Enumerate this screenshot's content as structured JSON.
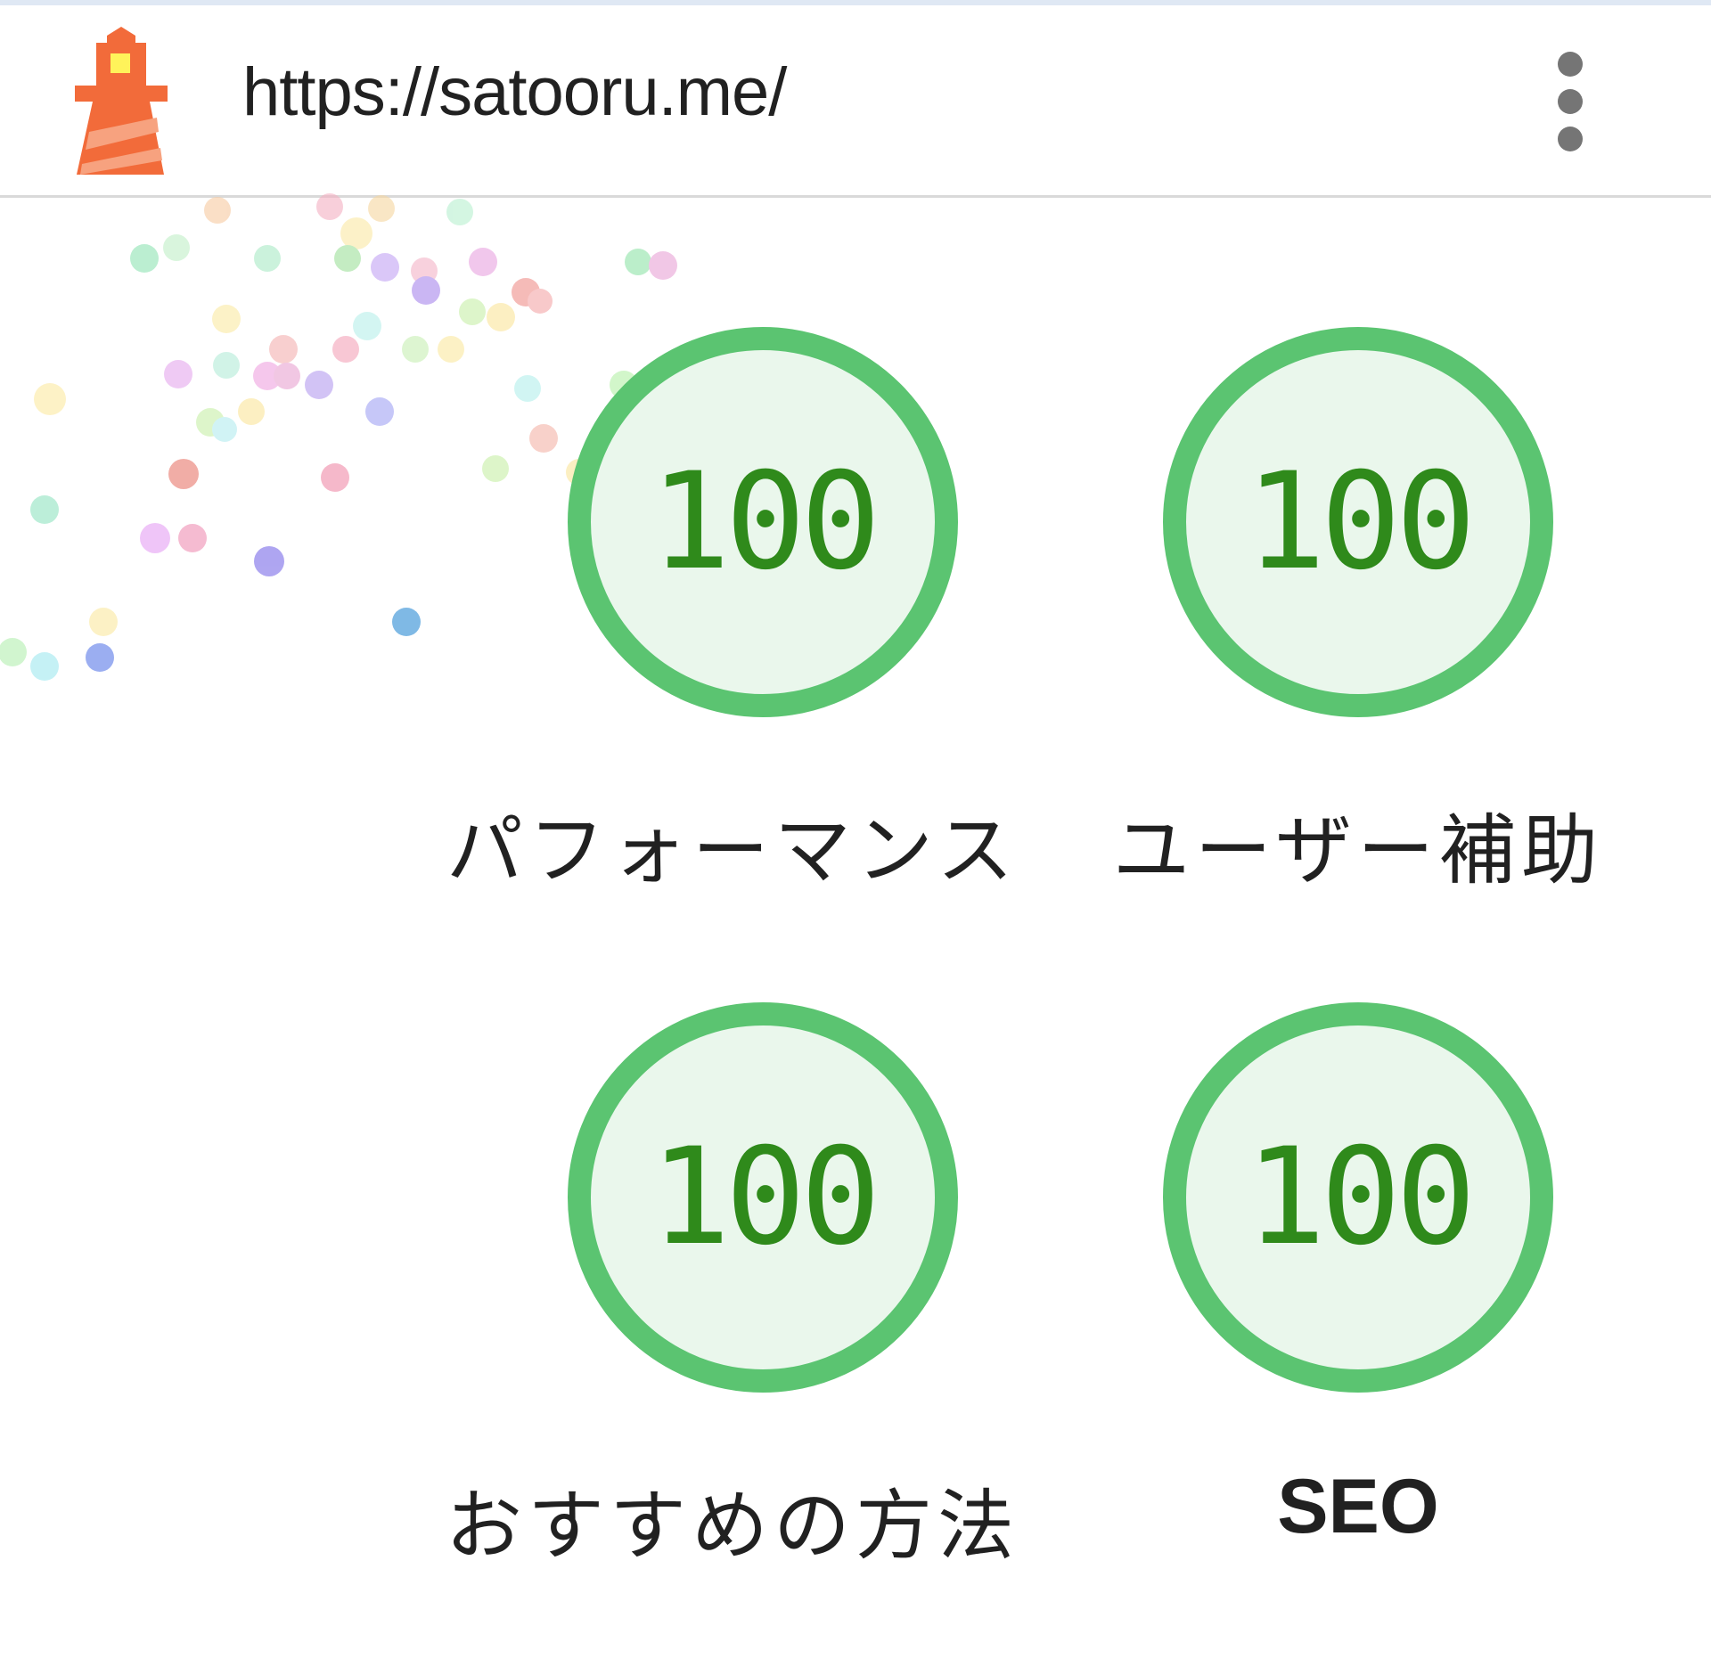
{
  "header": {
    "url": "https://satooru.me/",
    "logo_icon": "lighthouse-icon",
    "menu_icon": "more-vertical-icon"
  },
  "colors": {
    "pass_green": "#5bc471",
    "pass_fill": "#eaf7ec",
    "score_text": "#2f8a1b",
    "logo_orange": "#f26b3a",
    "logo_yellow": "#fff35a"
  },
  "gauges": [
    {
      "score": "100",
      "label": "パフォーマンス",
      "fraction": 1.0
    },
    {
      "score": "100",
      "label": "ユーザー補助",
      "fraction": 1.0
    },
    {
      "score": "100",
      "label": "おすすめの方法",
      "fraction": 1.0
    },
    {
      "score": "100",
      "label": "SEO",
      "fraction": 1.0
    }
  ]
}
